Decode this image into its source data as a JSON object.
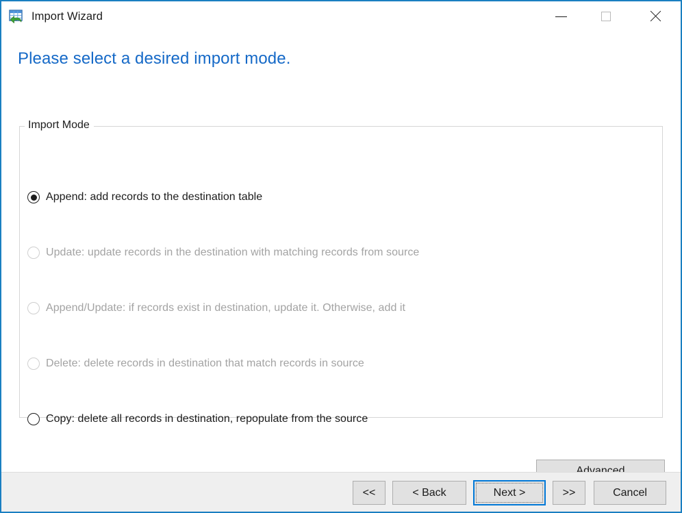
{
  "window": {
    "title": "Import Wizard",
    "icon": "import-table-icon",
    "accent_color": "#1a7fc1",
    "controls": {
      "minimize": "minimize-icon",
      "maximize": "maximize-icon",
      "close": "close-icon"
    }
  },
  "page": {
    "heading": "Please select a desired import mode.",
    "heading_color": "#1569c7"
  },
  "group": {
    "label": "Import Mode",
    "options": [
      {
        "label": "Append: add records to the destination table",
        "selected": true,
        "enabled": true
      },
      {
        "label": "Update: update records in the destination with matching records from source",
        "selected": false,
        "enabled": false
      },
      {
        "label": "Append/Update: if records exist in destination, update it. Otherwise, add it",
        "selected": false,
        "enabled": false
      },
      {
        "label": "Delete: delete records in destination that match records in source",
        "selected": false,
        "enabled": false
      },
      {
        "label": "Copy: delete all records in destination, repopulate from the source",
        "selected": false,
        "enabled": true
      }
    ]
  },
  "actions": {
    "advanced": "Advanced"
  },
  "footer": {
    "first": "<<",
    "back": "< Back",
    "next": "Next >",
    "last": ">>",
    "cancel": "Cancel",
    "focused_button": "Next >",
    "focus_color": "#0078d7"
  }
}
